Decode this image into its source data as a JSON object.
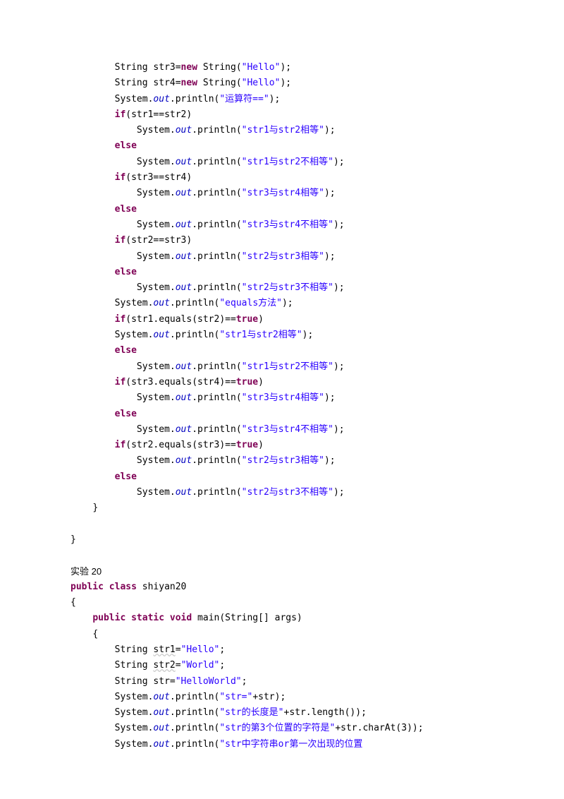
{
  "lines": [
    {
      "indent": 2,
      "parts": [
        {
          "t": "String str3="
        },
        {
          "t": "new",
          "c": "kw"
        },
        {
          "t": " String("
        },
        {
          "t": "\"Hello\"",
          "c": "str"
        },
        {
          "t": ");"
        }
      ]
    },
    {
      "indent": 2,
      "parts": [
        {
          "t": "String str4="
        },
        {
          "t": "new",
          "c": "kw"
        },
        {
          "t": " String("
        },
        {
          "t": "\"Hello\"",
          "c": "str"
        },
        {
          "t": ");"
        }
      ]
    },
    {
      "indent": 2,
      "parts": [
        {
          "t": "System."
        },
        {
          "t": "out",
          "c": "fld"
        },
        {
          "t": ".println("
        },
        {
          "t": "\"运算符==\"",
          "c": "str"
        },
        {
          "t": ");"
        }
      ]
    },
    {
      "indent": 2,
      "parts": [
        {
          "t": "if",
          "c": "kw"
        },
        {
          "t": "(str1==str2)"
        }
      ]
    },
    {
      "indent": 3,
      "parts": [
        {
          "t": "System."
        },
        {
          "t": "out",
          "c": "fld"
        },
        {
          "t": ".println("
        },
        {
          "t": "\"str1与str2相等\"",
          "c": "str"
        },
        {
          "t": ");"
        }
      ]
    },
    {
      "indent": 2,
      "parts": [
        {
          "t": "else",
          "c": "kw"
        }
      ]
    },
    {
      "indent": 3,
      "parts": [
        {
          "t": "System."
        },
        {
          "t": "out",
          "c": "fld"
        },
        {
          "t": ".println("
        },
        {
          "t": "\"str1与str2不相等\"",
          "c": "str"
        },
        {
          "t": ");"
        }
      ]
    },
    {
      "indent": 2,
      "parts": [
        {
          "t": "if",
          "c": "kw"
        },
        {
          "t": "(str3==str4)"
        }
      ]
    },
    {
      "indent": 3,
      "parts": [
        {
          "t": "System."
        },
        {
          "t": "out",
          "c": "fld"
        },
        {
          "t": ".println("
        },
        {
          "t": "\"str3与str4相等\"",
          "c": "str"
        },
        {
          "t": ");"
        }
      ]
    },
    {
      "indent": 2,
      "parts": [
        {
          "t": "else",
          "c": "kw"
        }
      ]
    },
    {
      "indent": 3,
      "parts": [
        {
          "t": "System."
        },
        {
          "t": "out",
          "c": "fld"
        },
        {
          "t": ".println("
        },
        {
          "t": "\"str3与str4不相等\"",
          "c": "str"
        },
        {
          "t": ");"
        }
      ]
    },
    {
      "indent": 2,
      "parts": [
        {
          "t": "if",
          "c": "kw"
        },
        {
          "t": "(str2==str3)"
        }
      ]
    },
    {
      "indent": 3,
      "parts": [
        {
          "t": "System."
        },
        {
          "t": "out",
          "c": "fld"
        },
        {
          "t": ".println("
        },
        {
          "t": "\"str2与str3相等\"",
          "c": "str"
        },
        {
          "t": ");"
        }
      ]
    },
    {
      "indent": 2,
      "parts": [
        {
          "t": "else",
          "c": "kw"
        }
      ]
    },
    {
      "indent": 3,
      "parts": [
        {
          "t": "System."
        },
        {
          "t": "out",
          "c": "fld"
        },
        {
          "t": ".println("
        },
        {
          "t": "\"str2与str3不相等\"",
          "c": "str"
        },
        {
          "t": ");"
        }
      ]
    },
    {
      "indent": 2,
      "parts": [
        {
          "t": "System."
        },
        {
          "t": "out",
          "c": "fld"
        },
        {
          "t": ".println("
        },
        {
          "t": "\"equals方法\"",
          "c": "str"
        },
        {
          "t": ");"
        }
      ]
    },
    {
      "indent": 2,
      "parts": [
        {
          "t": "if",
          "c": "kw"
        },
        {
          "t": "(str1.equals(str2)=="
        },
        {
          "t": "true",
          "c": "kw"
        },
        {
          "t": ")"
        }
      ]
    },
    {
      "indent": 2,
      "parts": [
        {
          "t": "System."
        },
        {
          "t": "out",
          "c": "fld"
        },
        {
          "t": ".println("
        },
        {
          "t": "\"str1与str2相等\"",
          "c": "str"
        },
        {
          "t": ");"
        }
      ]
    },
    {
      "indent": 2,
      "parts": [
        {
          "t": "else",
          "c": "kw"
        }
      ]
    },
    {
      "indent": 3,
      "parts": [
        {
          "t": "System."
        },
        {
          "t": "out",
          "c": "fld"
        },
        {
          "t": ".println("
        },
        {
          "t": "\"str1与str2不相等\"",
          "c": "str"
        },
        {
          "t": ");"
        }
      ]
    },
    {
      "indent": 2,
      "parts": [
        {
          "t": "if",
          "c": "kw"
        },
        {
          "t": "(str3.equals(str4)=="
        },
        {
          "t": "true",
          "c": "kw"
        },
        {
          "t": ")"
        }
      ]
    },
    {
      "indent": 3,
      "parts": [
        {
          "t": "System."
        },
        {
          "t": "out",
          "c": "fld"
        },
        {
          "t": ".println("
        },
        {
          "t": "\"str3与str4相等\"",
          "c": "str"
        },
        {
          "t": ");"
        }
      ]
    },
    {
      "indent": 2,
      "parts": [
        {
          "t": "else",
          "c": "kw"
        }
      ]
    },
    {
      "indent": 3,
      "parts": [
        {
          "t": "System."
        },
        {
          "t": "out",
          "c": "fld"
        },
        {
          "t": ".println("
        },
        {
          "t": "\"str3与str4不相等\"",
          "c": "str"
        },
        {
          "t": ");"
        }
      ]
    },
    {
      "indent": 2,
      "parts": [
        {
          "t": "if",
          "c": "kw"
        },
        {
          "t": "(str2.equals(str3)=="
        },
        {
          "t": "true",
          "c": "kw"
        },
        {
          "t": ")"
        }
      ]
    },
    {
      "indent": 3,
      "parts": [
        {
          "t": "System."
        },
        {
          "t": "out",
          "c": "fld"
        },
        {
          "t": ".println("
        },
        {
          "t": "\"str2与str3相等\"",
          "c": "str"
        },
        {
          "t": ");"
        }
      ]
    },
    {
      "indent": 2,
      "parts": [
        {
          "t": "else",
          "c": "kw"
        }
      ]
    },
    {
      "indent": 3,
      "parts": [
        {
          "t": "System."
        },
        {
          "t": "out",
          "c": "fld"
        },
        {
          "t": ".println("
        },
        {
          "t": "\"str2与str3不相等\"",
          "c": "str"
        },
        {
          "t": ");"
        }
      ]
    },
    {
      "indent": 1,
      "parts": [
        {
          "t": "}"
        }
      ]
    },
    {
      "indent": 0,
      "parts": [
        {
          "t": ""
        }
      ]
    },
    {
      "indent": 0,
      "parts": [
        {
          "t": "}"
        }
      ]
    },
    {
      "indent": 0,
      "parts": [
        {
          "t": ""
        }
      ]
    },
    {
      "indent": 0,
      "parts": [
        {
          "t": "实验 20",
          "c": "cjk"
        }
      ]
    },
    {
      "indent": 0,
      "parts": [
        {
          "t": "public",
          "c": "kw"
        },
        {
          "t": " "
        },
        {
          "t": "class",
          "c": "kw"
        },
        {
          "t": " shiyan20"
        }
      ]
    },
    {
      "indent": 0,
      "parts": [
        {
          "t": "{"
        }
      ]
    },
    {
      "indent": 1,
      "parts": [
        {
          "t": "public",
          "c": "kw"
        },
        {
          "t": " "
        },
        {
          "t": "static",
          "c": "kw"
        },
        {
          "t": " "
        },
        {
          "t": "void",
          "c": "kw"
        },
        {
          "t": " main(String[] args)"
        }
      ]
    },
    {
      "indent": 1,
      "parts": [
        {
          "t": "{"
        }
      ]
    },
    {
      "indent": 2,
      "parts": [
        {
          "t": "String "
        },
        {
          "t": "str1",
          "c": "u"
        },
        {
          "t": "="
        },
        {
          "t": "\"Hello\"",
          "c": "str"
        },
        {
          "t": ";"
        }
      ]
    },
    {
      "indent": 2,
      "parts": [
        {
          "t": "String "
        },
        {
          "t": "str2",
          "c": "u"
        },
        {
          "t": "="
        },
        {
          "t": "\"World\"",
          "c": "str"
        },
        {
          "t": ";"
        }
      ]
    },
    {
      "indent": 2,
      "parts": [
        {
          "t": "String str="
        },
        {
          "t": "\"HelloWorld\"",
          "c": "str"
        },
        {
          "t": ";"
        }
      ]
    },
    {
      "indent": 2,
      "parts": [
        {
          "t": "System."
        },
        {
          "t": "out",
          "c": "fld"
        },
        {
          "t": ".println("
        },
        {
          "t": "\"str=\"",
          "c": "str"
        },
        {
          "t": "+str);"
        }
      ]
    },
    {
      "indent": 2,
      "parts": [
        {
          "t": "System."
        },
        {
          "t": "out",
          "c": "fld"
        },
        {
          "t": ".println("
        },
        {
          "t": "\"str的长度是\"",
          "c": "str"
        },
        {
          "t": "+str.length());"
        }
      ]
    },
    {
      "indent": 2,
      "parts": [
        {
          "t": "System."
        },
        {
          "t": "out",
          "c": "fld"
        },
        {
          "t": ".println("
        },
        {
          "t": "\"str的第3个位置的字符是\"",
          "c": "str"
        },
        {
          "t": "+str.charAt(3));"
        }
      ]
    },
    {
      "indent": 2,
      "parts": [
        {
          "t": "System."
        },
        {
          "t": "out",
          "c": "fld"
        },
        {
          "t": ".println("
        },
        {
          "t": "\"str中字符串or第一次出现的位置",
          "c": "str"
        }
      ]
    }
  ],
  "indentUnit": "    "
}
